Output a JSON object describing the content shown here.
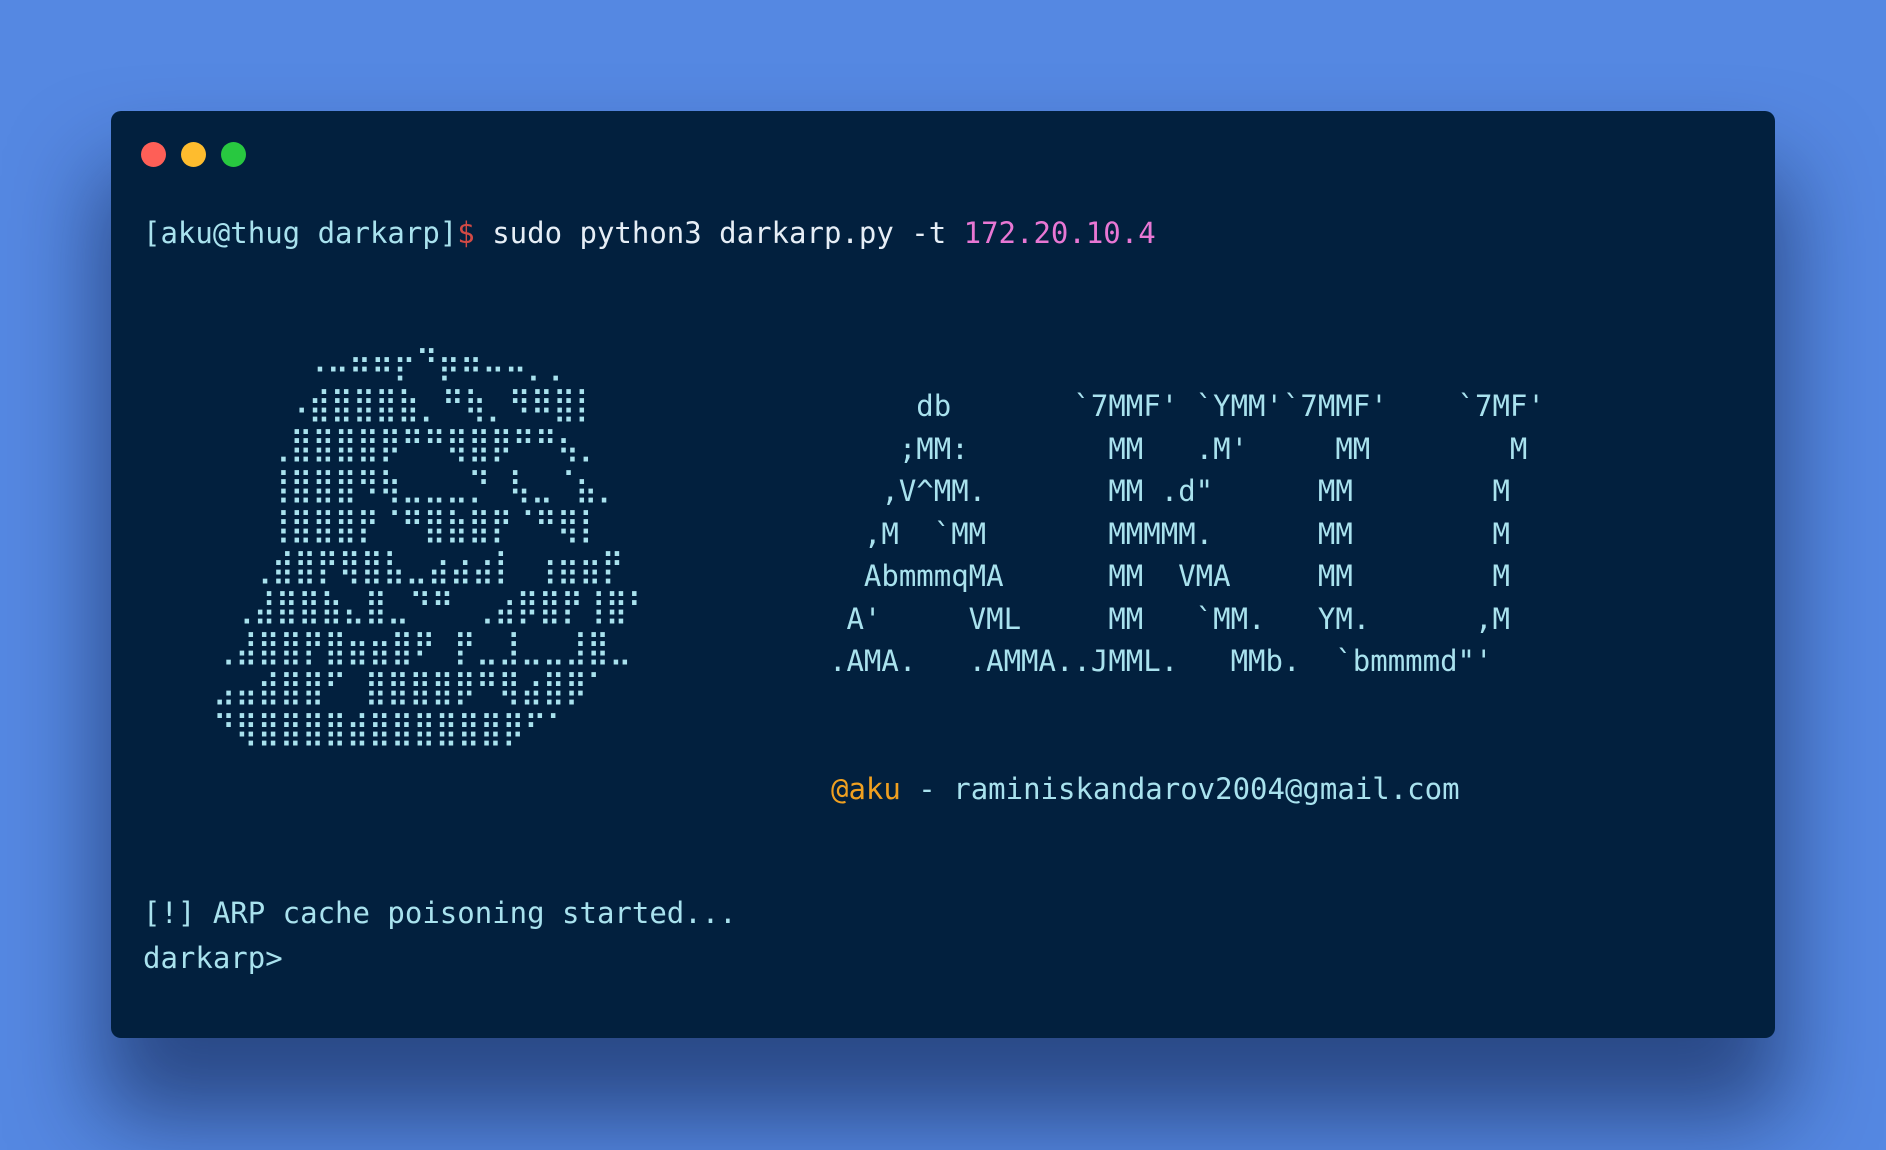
{
  "window": {
    "controls": [
      "close",
      "minimize",
      "maximize"
    ],
    "colors": {
      "background": "#02203e",
      "close": "#fe5f57",
      "minimize": "#febc2e",
      "maximize": "#28c840"
    }
  },
  "command": {
    "prompt_user": "[aku@thug darkarp]",
    "prompt_symbol": "$",
    "text": " sudo python3 darkarp.py -t ",
    "target_ip": "172.20.10.4"
  },
  "skull_art": [
    "     ⠠⠤⠶⠶⡖⠙⡶⠶⠤⠤⡀⡀",
    "    ⠠⣾⣿⣿⣿⣷⡀⠛⢷⡀⠻⠿⣿⡇",
    "   ⢀⣿⣿⣿⣿⡿⠛⠛⢿⣿⡿⠛⠛⢦⡀",
    "   ⢸⣿⣿⣿⠻⢷⣀⣀⣀⡙ ⢧⣀⠈⣦⡀",
    "   ⢸⣿⣿⣿⡟⠈⠛⣿⣷⣿⡟⠈⠛⢿⡇",
    "  ⢀⣾⣿⡟⢿⣿⣧⣀⣴⣴⣴⡇ ⢰⣶⣶⡟",
    " ⢀⣼⣿⣿⣷⣄⣿⣀⠙⠛ ⢀⣴⡿⣿⡟⢸⣿⠃",
    "⢀⣼⣿⣿⡟⣿⣶⣶⣿⠟ ⡟⣀⣸⣀⣀⣸⣿⣀",
    "⣠⣤⣾⣿⣿⠋ ⣿⣿⣿⣿⡿⠛⢿⣴⣿⡿⠁",
    "⠙⢿⣿⣿⣿⣿⣾⣿⣿⣿⣿⣿⣿⡿⠋⠁"
  ],
  "banner": {
    "lines": [
      "     db       `7MMF' `YMM'`7MMF'    `7MF'",
      "    ;MM:        MM   .M'     MM        M",
      "   ,V^MM.       MM .d\"      MM        M",
      "  ,M  `MM       MMMMM.      MM        M",
      "  AbmmmqMA      MM  VMA     MM        M",
      " A'     VML     MM   `MM.   YM.      ,M",
      ".AMA.   .AMMA..JMML.   MMb.  `bmmmmd\"'"
    ]
  },
  "credit": {
    "handle": "@aku",
    "separator": " - ",
    "email": "raminiskandarov2004@gmail.com"
  },
  "status": {
    "text": "[!] ARP cache poisoning started..."
  },
  "prompt": {
    "text": "darkarp>"
  }
}
